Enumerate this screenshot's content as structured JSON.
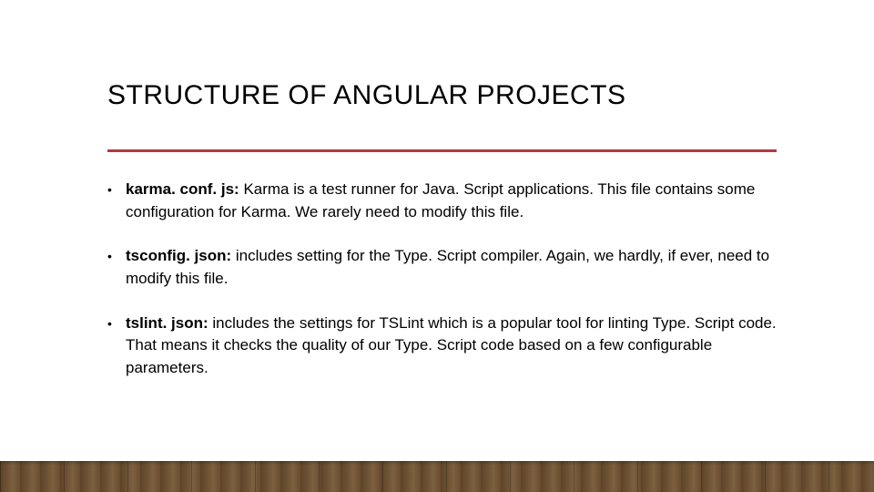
{
  "title": "STRUCTURE OF ANGULAR PROJECTS",
  "bullets": [
    {
      "bold": "karma. conf. js:",
      "text": " Karma is a test runner for Java. Script applications. This file contains some configuration for Karma. We rarely need to modify this file."
    },
    {
      "bold": "tsconfig. json:",
      "text": " includes setting for the Type. Script compiler. Again, we hardly, if ever, need to modify this file."
    },
    {
      "bold": "tslint. json:",
      "text": " includes the settings for TSLint which is a popular tool for linting Type. Script code. That means it checks the quality of our Type. Script code based on a few configurable parameters."
    }
  ]
}
